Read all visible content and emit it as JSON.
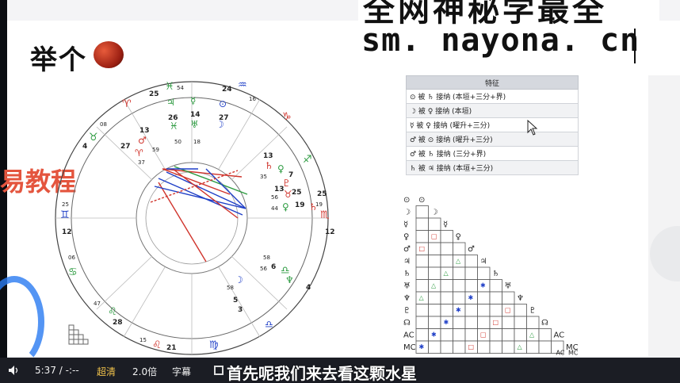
{
  "watermark": {
    "line1": "全网神秘学最全",
    "line2": "sm. nayona. cn"
  },
  "slide": {
    "title": "举个",
    "side_label": "易教程"
  },
  "chart": {
    "houses": [
      "4",
      "25",
      "12",
      "06",
      "28",
      "21",
      "4",
      "19",
      "25",
      "15",
      "16",
      "24",
      "54",
      "25",
      "08"
    ],
    "outer_labels": {
      "t1": "25",
      "t2": "54",
      "t3": "24",
      "t4": "16",
      "t5": "08",
      "t6": "4",
      "t7": "25",
      "t8": "12",
      "t9": "06",
      "t10": "47",
      "t11": "28",
      "t12": "15",
      "t13": "21",
      "t14": "4",
      "t15": "19",
      "t16": "25",
      "t17": "12"
    },
    "inner_labels": {
      "p1": "26",
      "p2": "14",
      "p3": "27",
      "p4": "13",
      "p5": "27",
      "p6": "59",
      "p7": "37",
      "p8": "50",
      "p9": "18",
      "p10": "13",
      "p11": "35",
      "p12": "7",
      "p13": "13",
      "p14": "25",
      "p15": "56",
      "p16": "44",
      "p17": "19",
      "p18": "58",
      "p19": "6",
      "p20": "56",
      "p21": "5",
      "p22": "58",
      "p23": "2",
      "p24": "8",
      "p25": "3"
    }
  },
  "table": {
    "header": "特征",
    "rows": [
      "⊙ 被 ♄ 接纳 (本垣+三分+界)",
      "☽ 被 ♀ 接纳 (本垣)",
      "☿ 被 ♀ 接纳 (曜升+三分)",
      "♂ 被 ⊙ 接纳 (曜升+三分)",
      "♂ 被 ♄ 接纳 (三分+界)",
      "♄ 被 ♃ 接纳 (本垣+三分)"
    ]
  },
  "grid": {
    "row_symbols": [
      "⊙",
      "☽",
      "☿",
      "♀",
      "♂",
      "♃",
      "♄",
      "♅",
      "♆",
      "♇",
      "☊",
      "AC",
      "MC"
    ],
    "footer_labels": [
      "AC",
      "MC"
    ]
  },
  "player": {
    "time": "5:37 / -:--",
    "quality": "超清",
    "speed": "2.0倍",
    "captions": "字幕",
    "subtitle": "首先呢我们来去看这颗水星"
  },
  "colors": {
    "accent_red": "#e4553e",
    "aspect_blue": "#1f3fc7",
    "aspect_green": "#2b9a3f",
    "aspect_red": "#d0342c"
  }
}
